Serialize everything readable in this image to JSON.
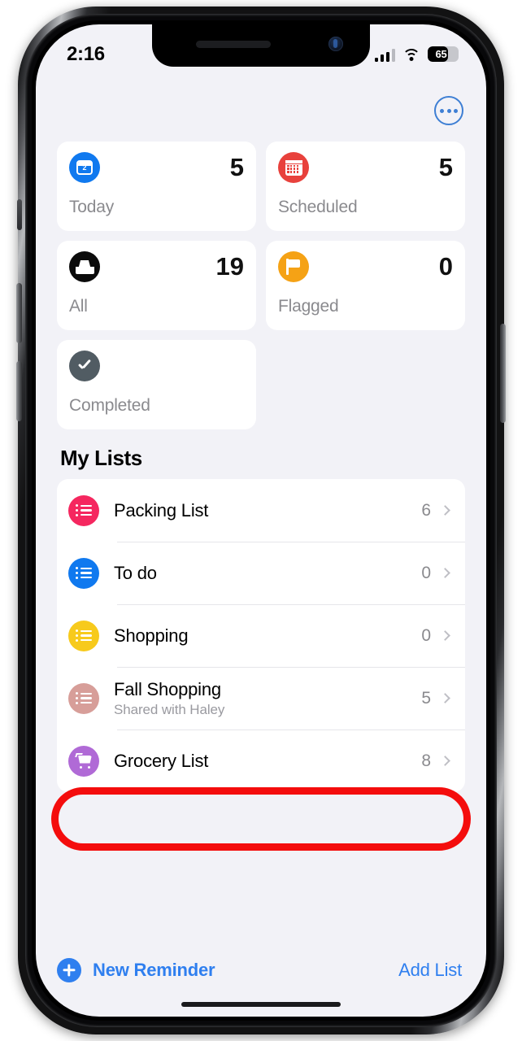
{
  "status_bar": {
    "time": "2:16",
    "battery_percent": "65",
    "battery_level": 65,
    "signal_icon": "cellular-signal-icon",
    "wifi_icon": "wifi-icon"
  },
  "header": {
    "more_icon": "more-circle-icon"
  },
  "summary_cards": [
    {
      "id": "today",
      "label": "Today",
      "count": "5",
      "icon": "calendar-today-icon",
      "icon_color": "#1079ef",
      "day_number": "2"
    },
    {
      "id": "scheduled",
      "label": "Scheduled",
      "count": "5",
      "icon": "calendar-icon",
      "icon_color": "#e8413c"
    },
    {
      "id": "all",
      "label": "All",
      "count": "19",
      "icon": "inbox-icon",
      "icon_color": "#0b0b0b"
    },
    {
      "id": "flagged",
      "label": "Flagged",
      "count": "0",
      "icon": "flag-icon",
      "icon_color": "#f5a215"
    },
    {
      "id": "completed",
      "label": "Completed",
      "count": "",
      "icon": "checkmark-icon",
      "icon_color": "#515c63"
    }
  ],
  "my_lists": {
    "title": "My Lists",
    "rows": [
      {
        "name": "Packing List",
        "subtitle": "",
        "count": "6",
        "icon": "list-bullet-icon",
        "icon_color": "#f5275f"
      },
      {
        "name": "To do",
        "subtitle": "",
        "count": "0",
        "icon": "list-bullet-icon",
        "icon_color": "#1079ef"
      },
      {
        "name": "Shopping",
        "subtitle": "",
        "count": "0",
        "icon": "list-bullet-icon",
        "icon_color": "#f7ca1c"
      },
      {
        "name": "Fall Shopping",
        "subtitle": "Shared with Haley",
        "count": "5",
        "icon": "list-bullet-icon",
        "icon_color": "#d79e99"
      },
      {
        "name": "Grocery List",
        "subtitle": "",
        "count": "8",
        "icon": "shopping-cart-icon",
        "icon_color": "#b06ad6"
      }
    ]
  },
  "toolbar": {
    "new_reminder_label": "New Reminder",
    "add_list_label": "Add List",
    "plus_icon": "plus-circle-icon"
  },
  "annotation": {
    "type": "highlight-ring",
    "color": "#f40d0d",
    "target": "Grocery List"
  }
}
